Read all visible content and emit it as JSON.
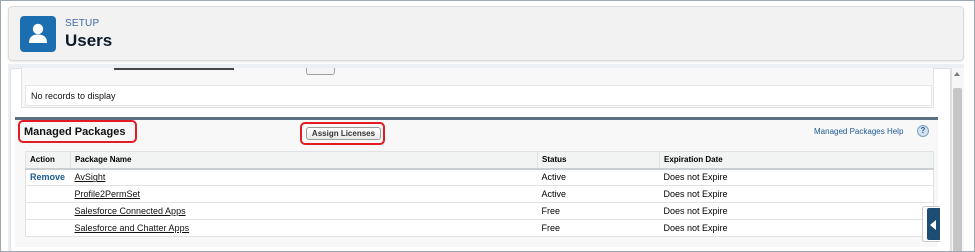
{
  "header": {
    "setup_label": "SETUP",
    "title": "Users",
    "icon": "user-icon",
    "icon_color": "#1b6fb0"
  },
  "previous_section": {
    "empty_message": "No records to display"
  },
  "managed_packages": {
    "title": "Managed Packages",
    "assign_button_label": "Assign Licenses",
    "help_link_label": "Managed Packages Help",
    "help_icon_glyph": "?",
    "highlight_color": "#e31c23",
    "columns": [
      "Action",
      "Package Name",
      "Status",
      "Expiration Date"
    ],
    "rows": [
      {
        "action": "Remove",
        "name": "AvSight",
        "status": "Active",
        "expiration": "Does not Expire"
      },
      {
        "action": "",
        "name": "Profile2PermSet",
        "status": "Active",
        "expiration": "Does not Expire"
      },
      {
        "action": "",
        "name": "Salesforce Connected Apps",
        "status": "Free",
        "expiration": "Does not Expire"
      },
      {
        "action": "",
        "name": "Salesforce and Chatter Apps",
        "status": "Free",
        "expiration": "Does not Expire"
      }
    ]
  },
  "side_panel": {
    "icon": "collapse-left-icon"
  }
}
